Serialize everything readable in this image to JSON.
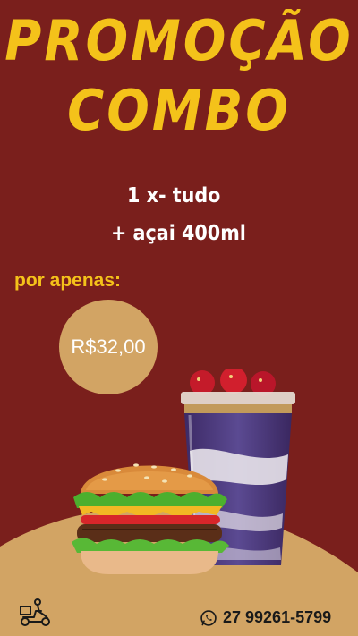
{
  "poster": {
    "title_line1": "PROMOÇÃO",
    "title_line2": "COMBO",
    "combo_line1": "1 x- tudo",
    "combo_line2": "+ açai 400ml",
    "by_only": "por apenas:",
    "price": "R$32,00",
    "phone": "27 99261-5799",
    "icons": [
      "burger-image",
      "acai-cup-image",
      "delivery-icon",
      "whatsapp-icon"
    ]
  },
  "colors": {
    "background": "#7a1f1c",
    "title": "#f4c21a",
    "accent_circle": "#d2a464",
    "ground": "#d2a464"
  }
}
